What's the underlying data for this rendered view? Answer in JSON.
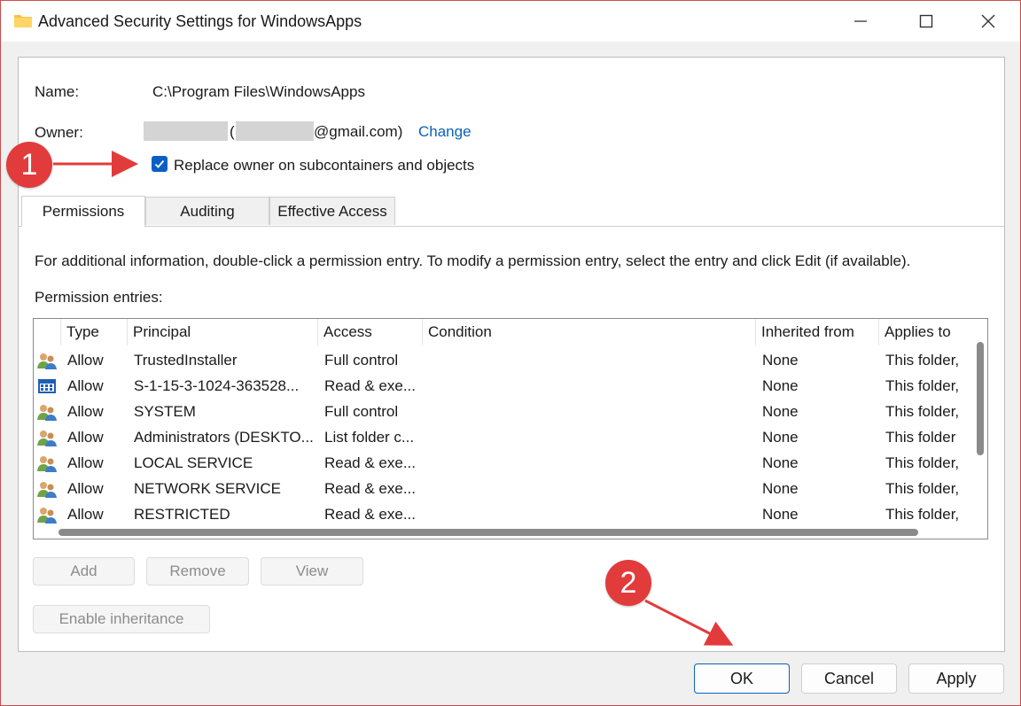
{
  "window": {
    "title": "Advanced Security Settings for WindowsApps"
  },
  "info": {
    "name_label": "Name:",
    "name_value": "C:\\Program Files\\WindowsApps",
    "owner_label": "Owner:",
    "owner_open_paren": "(",
    "owner_email_suffix": "@gmail.com)",
    "change_link": "Change",
    "replace_owner_label": "Replace owner on subcontainers and objects",
    "replace_owner_checked": true
  },
  "tabs": [
    {
      "label": "Permissions",
      "active": true
    },
    {
      "label": "Auditing",
      "active": false
    },
    {
      "label": "Effective Access",
      "active": false
    }
  ],
  "permissions": {
    "instructions": "For additional information, double-click a permission entry. To modify a permission entry, select the entry and click Edit (if available).",
    "entries_label": "Permission entries:",
    "columns": [
      "Type",
      "Principal",
      "Access",
      "Condition",
      "Inherited from",
      "Applies to"
    ],
    "rows": [
      {
        "icon": "users-icon",
        "type": "Allow",
        "principal": "TrustedInstaller",
        "access": "Full control",
        "condition": "",
        "inherited": "None",
        "applies": "This folder,"
      },
      {
        "icon": "app-package-icon",
        "type": "Allow",
        "principal": "S-1-15-3-1024-363528...",
        "access": "Read & exe...",
        "condition": "",
        "inherited": "None",
        "applies": "This folder,"
      },
      {
        "icon": "users-icon",
        "type": "Allow",
        "principal": "SYSTEM",
        "access": "Full control",
        "condition": "",
        "inherited": "None",
        "applies": "This folder,"
      },
      {
        "icon": "users-icon",
        "type": "Allow",
        "principal": "Administrators (DESKTO...",
        "access": "List folder c...",
        "condition": "",
        "inherited": "None",
        "applies": "This folder"
      },
      {
        "icon": "users-icon",
        "type": "Allow",
        "principal": "LOCAL SERVICE",
        "access": "Read & exe...",
        "condition": "",
        "inherited": "None",
        "applies": "This folder,"
      },
      {
        "icon": "users-icon",
        "type": "Allow",
        "principal": "NETWORK SERVICE",
        "access": "Read & exe...",
        "condition": "",
        "inherited": "None",
        "applies": "This folder,"
      },
      {
        "icon": "users-icon",
        "type": "Allow",
        "principal": "RESTRICTED",
        "access": "Read & exe...",
        "condition": "",
        "inherited": "None",
        "applies": "This folder,"
      }
    ],
    "buttons": {
      "add": "Add",
      "remove": "Remove",
      "view": "View",
      "enable_inheritance": "Enable inheritance"
    }
  },
  "footer": {
    "ok": "OK",
    "cancel": "Cancel",
    "apply": "Apply"
  },
  "annotations": {
    "step1": "1",
    "step2": "2",
    "color": "#e23b3b"
  }
}
